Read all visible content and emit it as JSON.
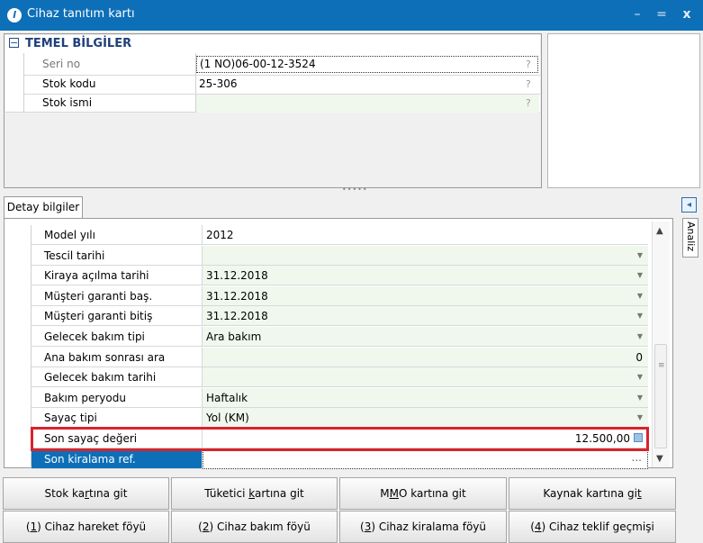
{
  "window": {
    "title": "Cihaz tanıtım kartı",
    "minimize": "–",
    "maximize": "=",
    "close": "x"
  },
  "group": {
    "title": "TEMEL BİLGİLER",
    "rows": [
      {
        "label": "Seri no",
        "value": "(1 NO)06-00-12-3524",
        "hint": "?"
      },
      {
        "label": "Stok kodu",
        "value": "25-306",
        "hint": "?"
      },
      {
        "label": "Stok ismi",
        "value": "",
        "hint": "?"
      }
    ]
  },
  "tab": {
    "label": "Detay bilgiler"
  },
  "side": {
    "analiz_label": "Analiz"
  },
  "details": [
    {
      "label": "Model yılı",
      "value": "2012",
      "dropdown": false
    },
    {
      "label": "Tescil tarihi",
      "value": "",
      "dropdown": true
    },
    {
      "label": "Kiraya açılma tarihi",
      "value": "31.12.2018",
      "dropdown": true
    },
    {
      "label": "Müşteri garanti baş.",
      "value": "31.12.2018",
      "dropdown": true
    },
    {
      "label": "Müşteri garanti bitiş",
      "value": "31.12.2018",
      "dropdown": true
    },
    {
      "label": "Gelecek bakım tipi",
      "value": "Ara bakım",
      "dropdown": true
    },
    {
      "label": "Ana bakım sonrası ara bakım",
      "value": "0",
      "dropdown": false
    },
    {
      "label": "Gelecek bakım tarihi",
      "value": "",
      "dropdown": true
    },
    {
      "label": "Bakım peryodu",
      "value": "Haftalık",
      "dropdown": true
    },
    {
      "label": "Sayaç tipi",
      "value": "Yol (KM)",
      "dropdown": true
    },
    {
      "label": "Son sayaç değeri",
      "value": "12.500,00",
      "dropdown": false
    },
    {
      "label": "Son kiralama ref.",
      "value": "",
      "dropdown": false,
      "ellipsis": "..."
    }
  ],
  "buttons": {
    "row1": [
      {
        "pre": "Stok ka",
        "u": "r",
        "post": "tına git"
      },
      {
        "pre": "Tüketici ",
        "u": "k",
        "post": "artına git"
      },
      {
        "pre": "M",
        "u": "M",
        "post": "O kartına git"
      },
      {
        "pre": "Kaynak kartına gi",
        "u": "t",
        "post": ""
      }
    ],
    "row2": [
      {
        "pre": "(",
        "u": "1",
        "post": ") Cihaz hareket föyü"
      },
      {
        "pre": "(",
        "u": "2",
        "post": ") Cihaz bakım föyü"
      },
      {
        "pre": "(",
        "u": "3",
        "post": ") Cihaz kiralama föyü"
      },
      {
        "pre": "(",
        "u": "4",
        "post": ") Cihaz teklif geçmişi"
      }
    ]
  },
  "colors": {
    "titlebar": "#0d6fb8",
    "selection": "#0d6fb8",
    "highlight_border": "#d9232a",
    "group_title": "#1f3f7a"
  }
}
